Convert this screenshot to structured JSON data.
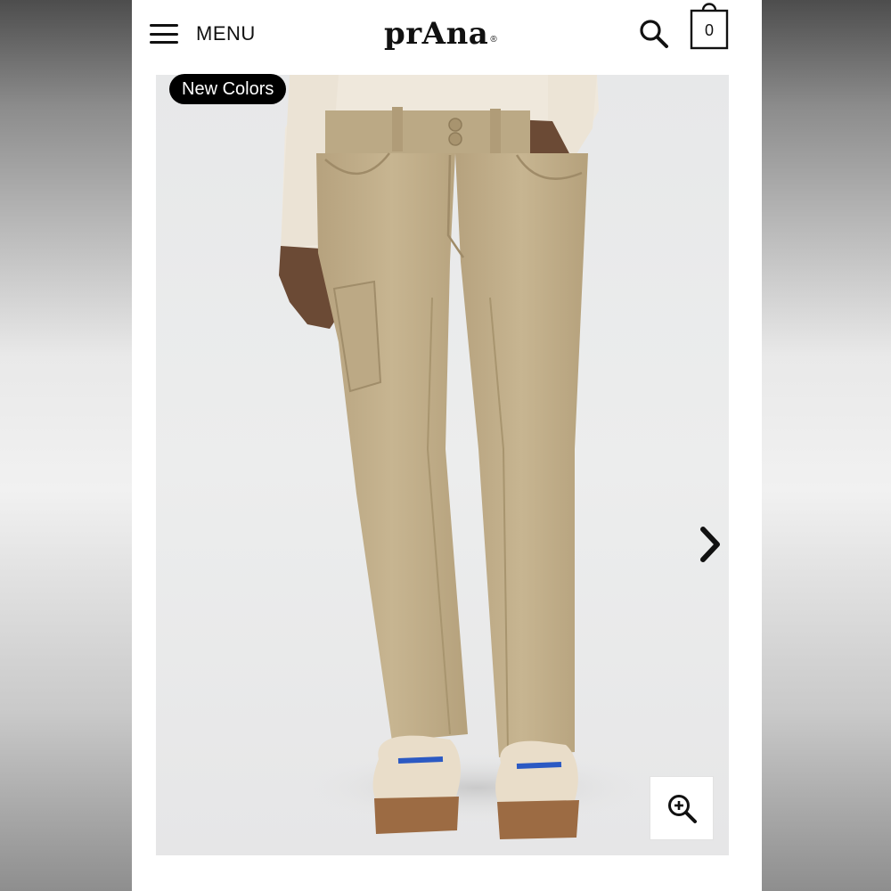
{
  "header": {
    "menu_label": "MENU",
    "logo_text": "prAna",
    "logo_mark": "®",
    "cart_count": "0",
    "icons": {
      "menu": "hamburger-icon",
      "search": "search-icon",
      "cart": "shopping-bag-icon"
    }
  },
  "product": {
    "badge": "New Colors",
    "image_subject": "khaki pants",
    "icons": {
      "next": "chevron-right-icon",
      "zoom": "zoom-in-icon"
    }
  },
  "colors": {
    "page_background": "#ffffff",
    "badge_background": "#000000",
    "badge_text": "#ffffff",
    "pants": "#c2b08d",
    "shirt": "#efe8dc",
    "image_background": "#e9eaea"
  }
}
